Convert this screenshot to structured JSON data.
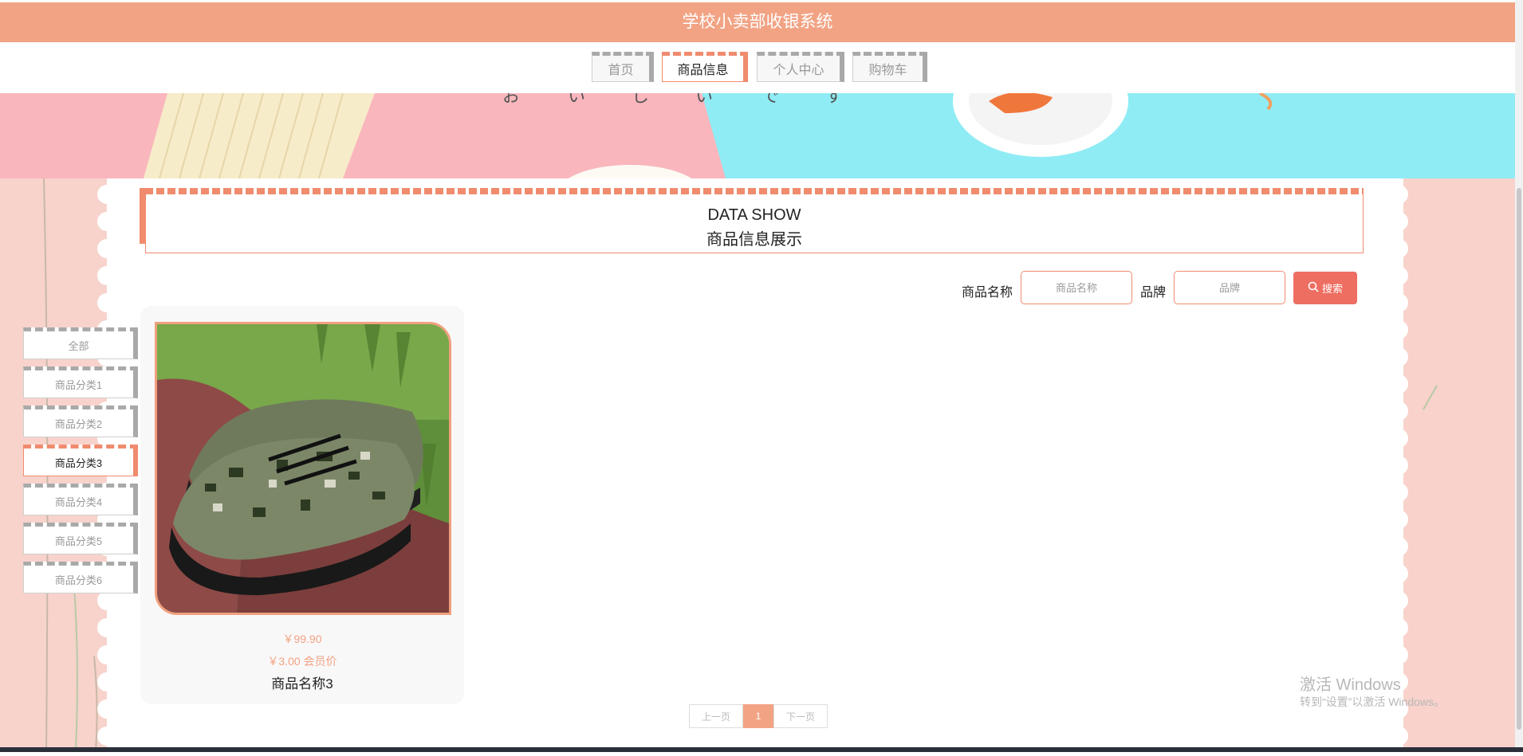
{
  "app": {
    "title": "学校小卖部收银系统"
  },
  "nav": {
    "tabs": [
      {
        "label": "首页",
        "active": false
      },
      {
        "label": "商品信息",
        "active": true
      },
      {
        "label": "个人中心",
        "active": false
      },
      {
        "label": "购物车",
        "active": false
      }
    ]
  },
  "banner": {
    "kana": [
      "お",
      "い",
      "し",
      "い",
      "で",
      "す"
    ]
  },
  "section": {
    "title_en": "DATA SHOW",
    "title_cn": "商品信息展示"
  },
  "search": {
    "name_label": "商品名称",
    "name_placeholder": "商品名称",
    "brand_label": "品牌",
    "brand_placeholder": "品牌",
    "button_label": "搜索"
  },
  "categories": {
    "items": [
      {
        "label": "全部",
        "active": false
      },
      {
        "label": "商品分类1",
        "active": false
      },
      {
        "label": "商品分类2",
        "active": false
      },
      {
        "label": "商品分类3",
        "active": true
      },
      {
        "label": "商品分类4",
        "active": false
      },
      {
        "label": "商品分类5",
        "active": false
      },
      {
        "label": "商品分类6",
        "active": false
      }
    ]
  },
  "products": [
    {
      "price": "￥99.90",
      "member_price": "￥3.00 会员价",
      "name": "商品名称3"
    }
  ],
  "pagination": {
    "prev": "上一页",
    "current": "1",
    "next": "下一页"
  },
  "watermark": {
    "line1": "激活 Windows",
    "line2": "转到“设置”以激活 Windows。"
  },
  "colors": {
    "accent": "#f2a384",
    "highlight": "#f08b6e",
    "search_button": "#ee6e62"
  }
}
